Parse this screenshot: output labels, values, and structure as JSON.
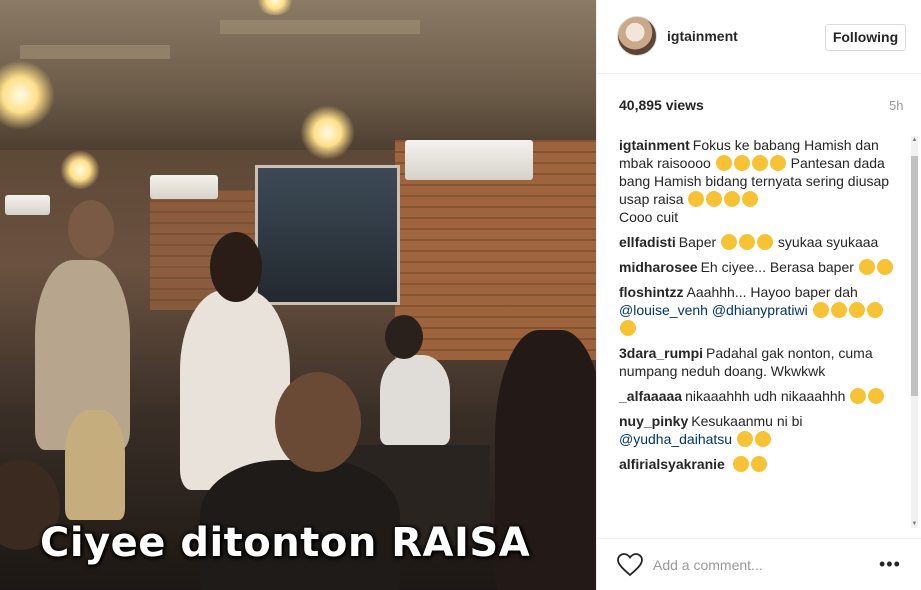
{
  "video": {
    "caption": "Ciyee ditonton RAISA"
  },
  "header": {
    "username": "igtainment",
    "follow_label": "Following"
  },
  "stats": {
    "views": "40,895 views",
    "time": "5h"
  },
  "comments": [
    {
      "user": "igtainment",
      "parts": [
        {
          "t": "text",
          "v": "Fokus ke babang Hamish dan mbak raisoooo "
        },
        {
          "t": "emoji",
          "v": "grin"
        },
        {
          "t": "emoji",
          "v": "sweat"
        },
        {
          "t": "emoji",
          "v": "grin"
        },
        {
          "t": "emoji",
          "v": "sweat"
        },
        {
          "t": "text",
          "v": " Pantesan dada bang Hamish bidang ternyata sering diusap usap raisa "
        },
        {
          "t": "emoji",
          "v": "joy"
        },
        {
          "t": "emoji",
          "v": "joy"
        },
        {
          "t": "emoji",
          "v": "joy"
        },
        {
          "t": "emoji",
          "v": "joy"
        },
        {
          "t": "br"
        },
        {
          "t": "text",
          "v": "Cooo cuit"
        }
      ]
    },
    {
      "user": "ellfadisti",
      "parts": [
        {
          "t": "text",
          "v": "Baper "
        },
        {
          "t": "emoji",
          "v": "heart"
        },
        {
          "t": "emoji",
          "v": "heart"
        },
        {
          "t": "emoji",
          "v": "heart"
        },
        {
          "t": "text",
          "v": " syukaa syukaaa"
        }
      ]
    },
    {
      "user": "midharosee",
      "parts": [
        {
          "t": "text",
          "v": "Eh ciyee... Berasa baper "
        },
        {
          "t": "emoji",
          "v": "joy"
        },
        {
          "t": "emoji",
          "v": "joy"
        }
      ]
    },
    {
      "user": "floshintzz",
      "parts": [
        {
          "t": "text",
          "v": "Aaahhh... Hayoo baper dah "
        },
        {
          "t": "mention",
          "v": "@louise_venh"
        },
        {
          "t": "text",
          "v": " "
        },
        {
          "t": "mention",
          "v": "@dhianypratiwi"
        },
        {
          "t": "text",
          "v": " "
        },
        {
          "t": "emoji",
          "v": "joy"
        },
        {
          "t": "emoji",
          "v": "joy"
        },
        {
          "t": "emoji",
          "v": "joy"
        },
        {
          "t": "emoji",
          "v": "sweat"
        },
        {
          "t": "emoji",
          "v": "sweat"
        }
      ]
    },
    {
      "user": "3dara_rumpi",
      "parts": [
        {
          "t": "text",
          "v": "Padahal gak nonton, cuma numpang neduh doang. Wkwkwk"
        }
      ]
    },
    {
      "user": "_alfaaaaa",
      "parts": [
        {
          "t": "text",
          "v": "nikaaahhh udh nikaaahhh "
        },
        {
          "t": "emoji",
          "v": "heart"
        },
        {
          "t": "emoji",
          "v": "heart"
        }
      ]
    },
    {
      "user": "nuy_pinky",
      "parts": [
        {
          "t": "text",
          "v": "Kesukaanmu ni bi "
        },
        {
          "t": "mention",
          "v": "@yudha_daihatsu"
        },
        {
          "t": "text",
          "v": " "
        },
        {
          "t": "emoji",
          "v": "grin"
        },
        {
          "t": "emoji",
          "v": "grin"
        }
      ]
    },
    {
      "user": "alfirialsyakranie",
      "parts": [
        {
          "t": "text",
          "v": " "
        },
        {
          "t": "emoji",
          "v": "joy"
        },
        {
          "t": "emoji",
          "v": "joy"
        }
      ]
    }
  ],
  "footer": {
    "comment_placeholder": "Add a comment...",
    "more_label": "•••"
  },
  "icons": {
    "like": "heart-outline-icon",
    "more": "more-options-icon"
  },
  "colors": {
    "mention": "#003569",
    "muted": "#999999",
    "border": "#efefef"
  }
}
